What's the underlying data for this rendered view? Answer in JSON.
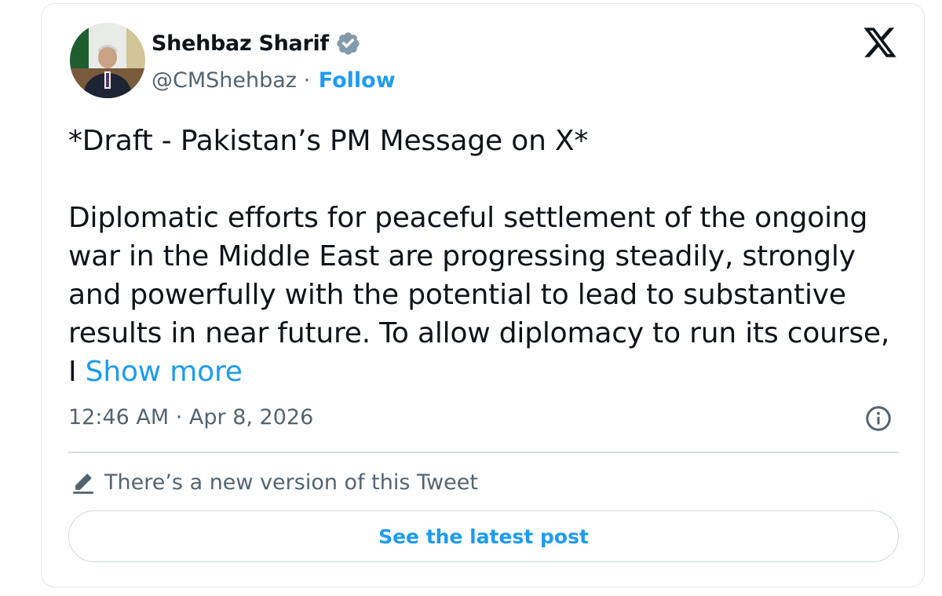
{
  "author": {
    "name": "Shehbaz Sharif",
    "handle": "@CMShehbaz",
    "separator": " · ",
    "follow_label": "Follow",
    "verified_color": "#829aab"
  },
  "header": {
    "logo_icon": "x-logo-icon"
  },
  "tweet": {
    "title_line": "*Draft - Pakistan’s PM Message on X*",
    "body_lines": [
      "Diplomatic efforts for peaceful settlement of the ongoing",
      "war in the Middle East are progressing steadily, strongly",
      "and powerfully with the potential to lead to substantive",
      "results in near future. To allow diplomacy to run its course,"
    ],
    "truncated_text": "I ",
    "show_more_label": "Show more",
    "time": "12:46 AM",
    "date": "Apr 8, 2026",
    "meta_separator": " · "
  },
  "edit_notice": {
    "icon": "pencil-icon",
    "text": "There’s a new version of this Tweet",
    "button_label": "See the latest post"
  },
  "colors": {
    "accent": "#1d9bf0",
    "secondary_text": "#536471",
    "primary_text": "#0f1419",
    "border": "#cfd9de"
  }
}
